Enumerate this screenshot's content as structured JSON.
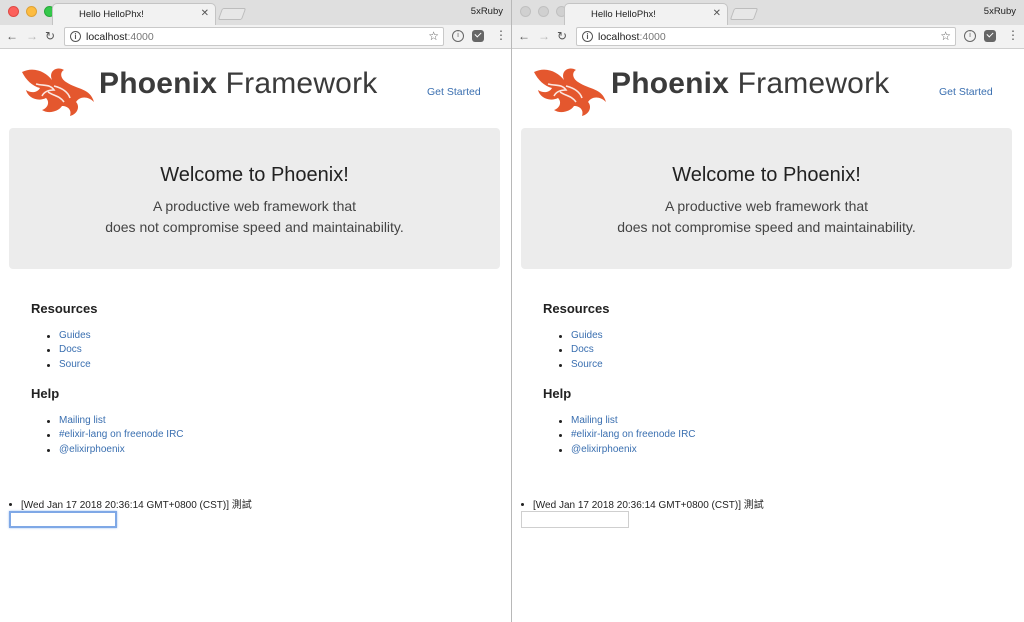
{
  "windows": [
    {
      "tab_title": "Hello HelloPhx!",
      "profile": "5xRuby",
      "url_host": "localhost",
      "url_port": ":4000",
      "logo_bold": "Phoenix",
      "logo_light": "Framework",
      "get_started": "Get Started",
      "hero_title": "Welcome to Phoenix!",
      "hero_line1": "A productive web framework that",
      "hero_line2": "does not compromise speed and maintainability.",
      "resources_heading": "Resources",
      "resources": [
        "Guides",
        "Docs",
        "Source"
      ],
      "help_heading": "Help",
      "help": [
        "Mailing list",
        "#elixir-lang on freenode IRC",
        "@elixirphoenix"
      ],
      "message": "[Wed Jan 17 2018 20:36:14 GMT+0800 (CST)] 測試",
      "input_value": "",
      "input_focused": true
    },
    {
      "tab_title": "Hello HelloPhx!",
      "profile": "5xRuby",
      "url_host": "localhost",
      "url_port": ":4000",
      "logo_bold": "Phoenix",
      "logo_light": "Framework",
      "get_started": "Get Started",
      "hero_title": "Welcome to Phoenix!",
      "hero_line1": "A productive web framework that",
      "hero_line2": "does not compromise speed and maintainability.",
      "resources_heading": "Resources",
      "resources": [
        "Guides",
        "Docs",
        "Source"
      ],
      "help_heading": "Help",
      "help": [
        "Mailing list",
        "#elixir-lang on freenode IRC",
        "@elixirphoenix"
      ],
      "message": "[Wed Jan 17 2018 20:36:14 GMT+0800 (CST)] 測試",
      "input_value": "",
      "input_focused": false
    }
  ],
  "icons": {
    "back": "arrow-left-icon",
    "forward": "arrow-right-icon",
    "reload": "reload-icon",
    "info": "info-icon",
    "bookmark": "star-icon",
    "extension1": "extension-icon",
    "extension2": "pocket-icon",
    "menu": "kebab-menu-icon",
    "logo": "phoenix-bird-icon"
  },
  "colors": {
    "link": "#3a6fb0",
    "logo_orange": "#e4572e",
    "jumbotron_bg": "#ececec",
    "focus_ring": "#7fa8e6"
  }
}
